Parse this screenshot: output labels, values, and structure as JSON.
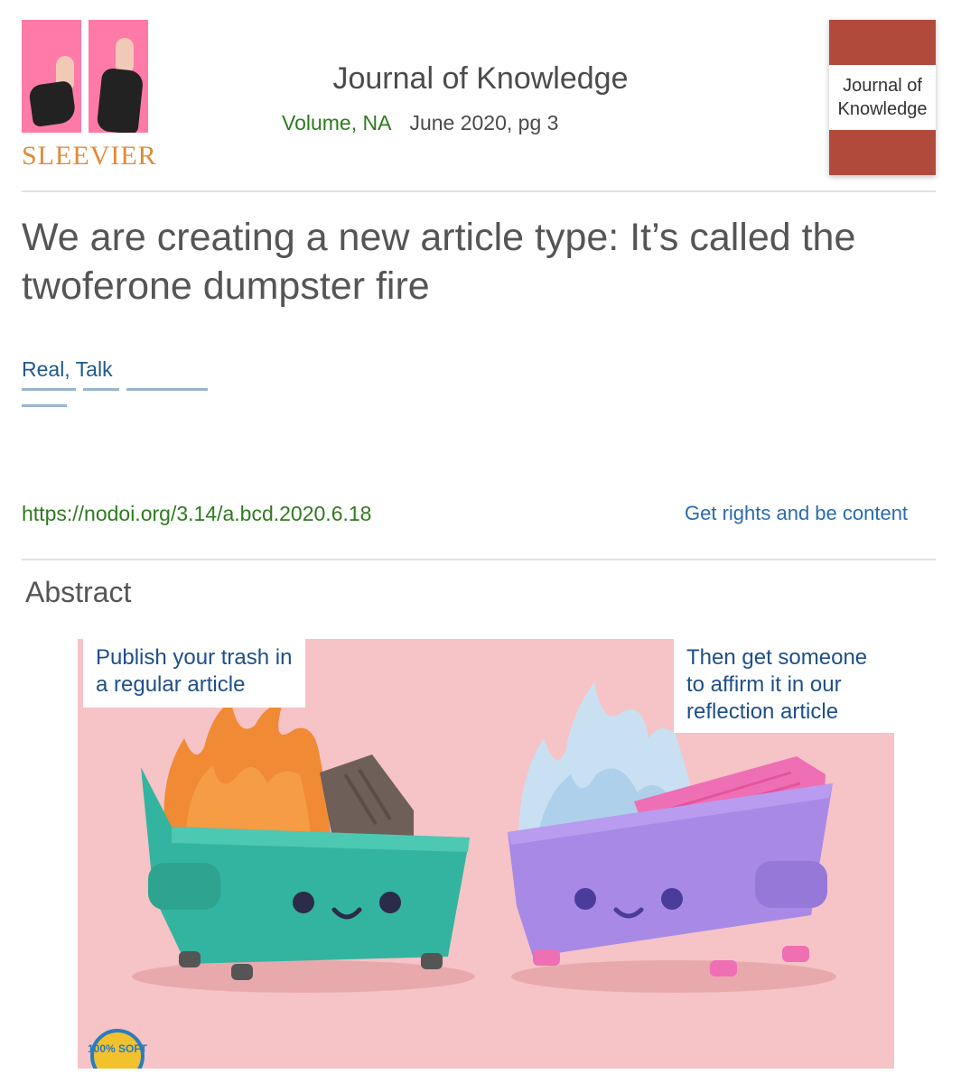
{
  "header": {
    "publisher_name": "SLEEVIER",
    "journal_title": "Journal of Knowledge",
    "volume": "Volume, NA",
    "date_page": "June 2020, pg 3",
    "cover_title": "Journal of Knowledge"
  },
  "article": {
    "title": "We are creating a new article type: It’s called the twoferone dumpster fire",
    "authors": "Real, Talk",
    "doi": "https://nodoi.org/3.14/a.bcd.2020.6.18",
    "rights_link": "Get rights and be content"
  },
  "abstract": {
    "heading": "Abstract",
    "caption_left": "Publish your trash in a regular article",
    "caption_right": "Then get someone to affirm it in our reflection article",
    "badge_text": "100% SOFT"
  },
  "colors": {
    "link_green": "#2e7a1f",
    "link_blue": "#2a6bb0",
    "author_blue": "#1d5a8f",
    "cover_red": "#b24a3c",
    "background_pink": "#f6c3c6"
  }
}
